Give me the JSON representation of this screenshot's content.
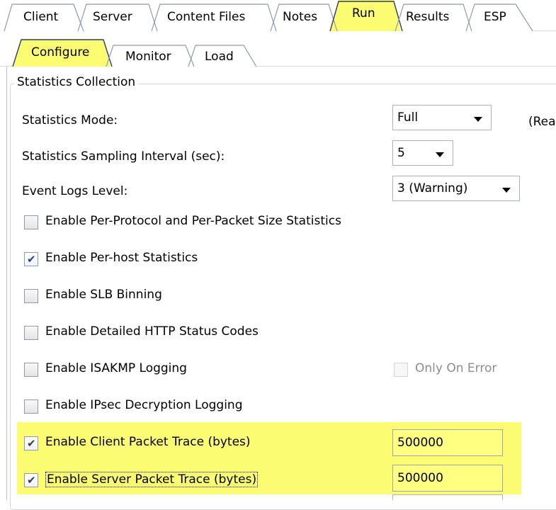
{
  "tabs_top": [
    {
      "label": "Client"
    },
    {
      "label": "Server"
    },
    {
      "label": "Content Files"
    },
    {
      "label": "Notes"
    },
    {
      "label": "Run",
      "active": true
    },
    {
      "label": "Results"
    },
    {
      "label": "ESP"
    }
  ],
  "tabs_sub": [
    {
      "label": "Configure",
      "active": true
    },
    {
      "label": "Monitor"
    },
    {
      "label": "Load"
    }
  ],
  "group": {
    "title": "Statistics Collection"
  },
  "settings": {
    "stats_mode": {
      "label": "Statistics Mode:",
      "value": "Full",
      "trailing": "(Rea"
    },
    "sampling_interval": {
      "label": "Statistics Sampling Interval (sec):",
      "value": "5"
    },
    "event_logs_level": {
      "label": "Event Logs Level:",
      "value": "3 (Warning)"
    }
  },
  "checkboxes": [
    {
      "label": "Enable Per-Protocol and Per-Packet Size Statistics",
      "checked": false
    },
    {
      "label": "Enable Per-host Statistics",
      "checked": true
    },
    {
      "label": "Enable SLB Binning",
      "checked": false
    },
    {
      "label": "Enable Detailed HTTP Status Codes",
      "checked": false
    },
    {
      "label": "Enable ISAKMP Logging",
      "checked": false
    },
    {
      "label": "Enable IPsec Decryption Logging",
      "checked": false
    },
    {
      "label": "Enable Client Packet Trace (bytes)",
      "checked": true
    },
    {
      "label": "Enable Server Packet Trace (bytes)",
      "checked": true
    }
  ],
  "only_on_error": {
    "label": "Only On Error",
    "checked": false,
    "disabled": true
  },
  "client_trace_bytes": "500000",
  "server_trace_bytes": "500000",
  "colors": {
    "highlight": "#fcfc72",
    "accent_tick": "#1c3e9a"
  }
}
